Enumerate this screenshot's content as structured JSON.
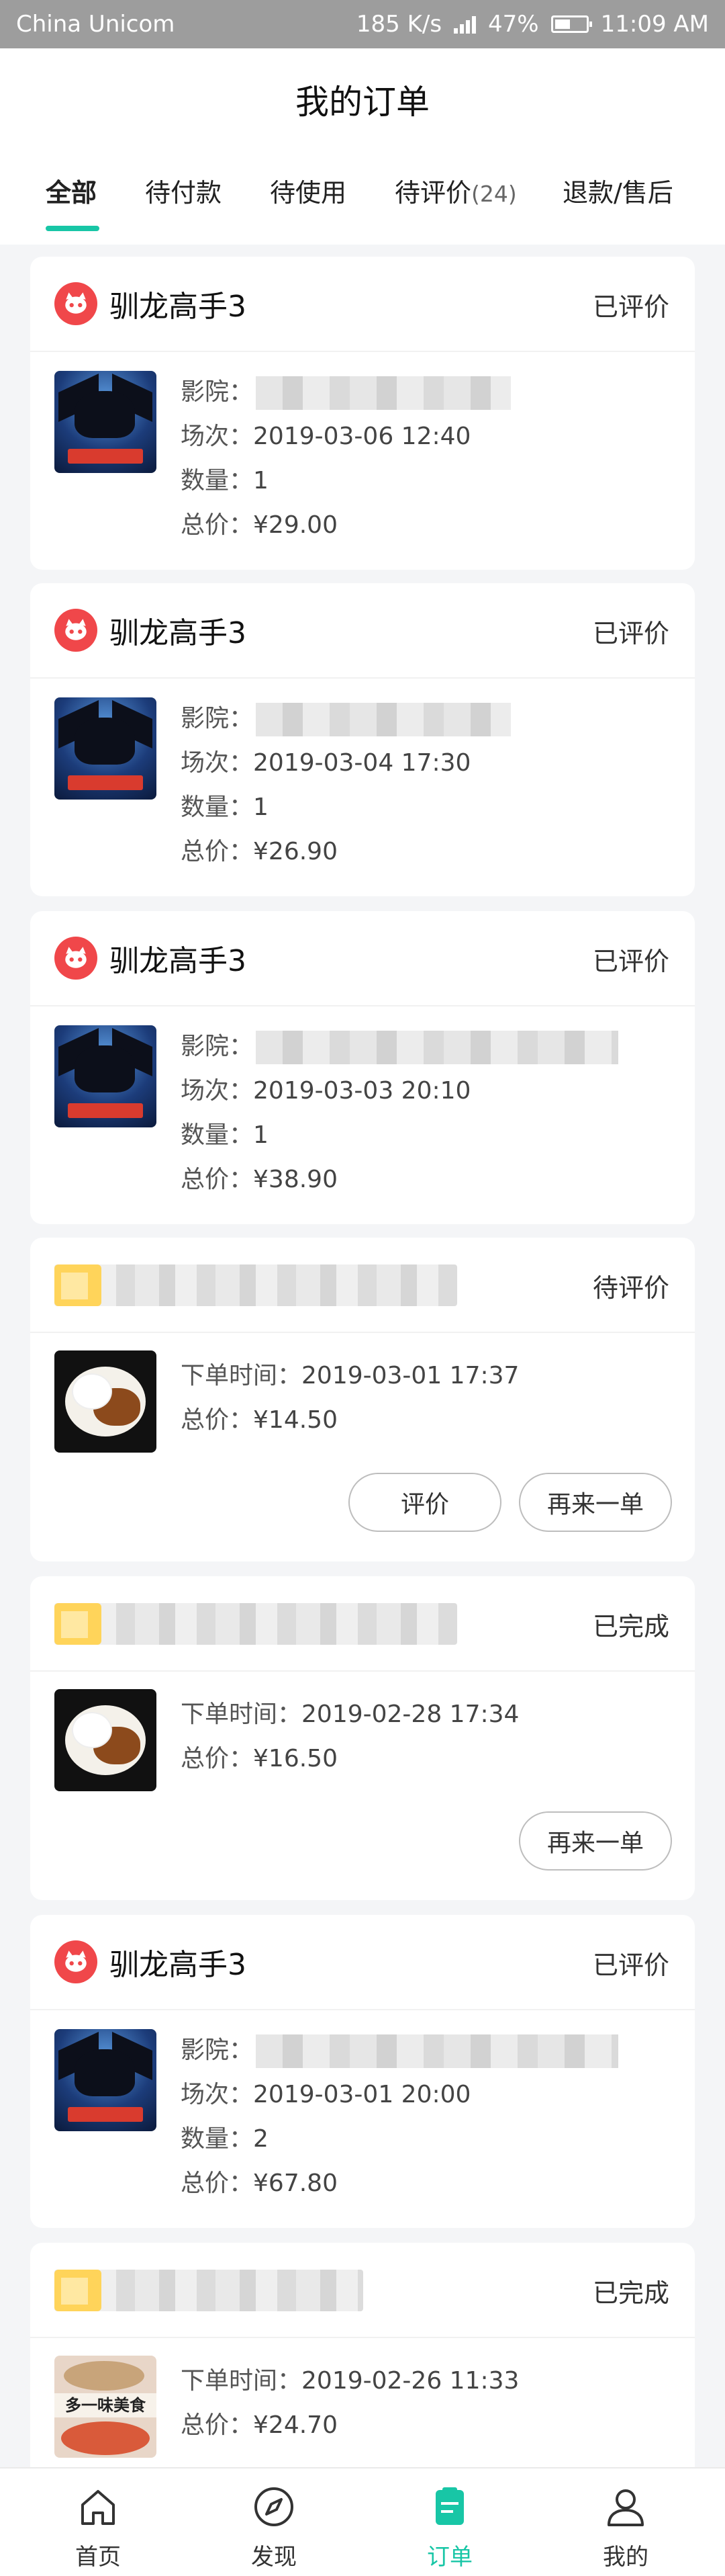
{
  "status_bar": {
    "carrier": "China Unicom",
    "speed": "185 K/s",
    "battery": "47%",
    "time": "11:09 AM"
  },
  "header": {
    "title": "我的订单"
  },
  "tabs": [
    {
      "label": "全部",
      "count": ""
    },
    {
      "label": "待付款",
      "count": ""
    },
    {
      "label": "待使用",
      "count": ""
    },
    {
      "label": "待评价",
      "count": "(24)"
    },
    {
      "label": "退款/售后",
      "count": ""
    }
  ],
  "labels": {
    "cinema": "影院：",
    "session": "场次：",
    "quantity": "数量：",
    "total": "总价：",
    "order_time": "下单时间："
  },
  "orders": [
    {
      "type": "movie",
      "shop": "驯龙高手3",
      "status": "已评价",
      "session": "2019-03-06 12:40",
      "quantity": "1",
      "total": "¥29.00"
    },
    {
      "type": "movie",
      "shop": "驯龙高手3",
      "status": "已评价",
      "session": "2019-03-04 17:30",
      "quantity": "1",
      "total": "¥26.90"
    },
    {
      "type": "movie",
      "shop": "驯龙高手3",
      "status": "已评价",
      "session": "2019-03-03 20:10",
      "quantity": "1",
      "total": "¥38.90"
    },
    {
      "type": "food",
      "status": "待评价",
      "order_time": "2019-03-01 17:37",
      "total": "¥14.50",
      "buttons": [
        "评价",
        "再来一单"
      ]
    },
    {
      "type": "food",
      "status": "已完成",
      "order_time": "2019-02-28 17:34",
      "total": "¥16.50",
      "buttons": [
        "再来一单"
      ]
    },
    {
      "type": "movie",
      "shop": "驯龙高手3",
      "status": "已评价",
      "session": "2019-03-01 20:00",
      "quantity": "2",
      "total": "¥67.80"
    },
    {
      "type": "food",
      "status": "已完成",
      "order_time": "2019-02-26 11:33",
      "total": "¥24.70",
      "image_text": "多一味美食"
    }
  ],
  "bottom_nav": [
    {
      "label": "首页",
      "icon": "home-icon"
    },
    {
      "label": "发现",
      "icon": "compass-icon"
    },
    {
      "label": "订单",
      "icon": "orders-icon"
    },
    {
      "label": "我的",
      "icon": "profile-icon"
    }
  ],
  "colors": {
    "accent": "#18c6a6",
    "brand_red": "#f0474a"
  }
}
